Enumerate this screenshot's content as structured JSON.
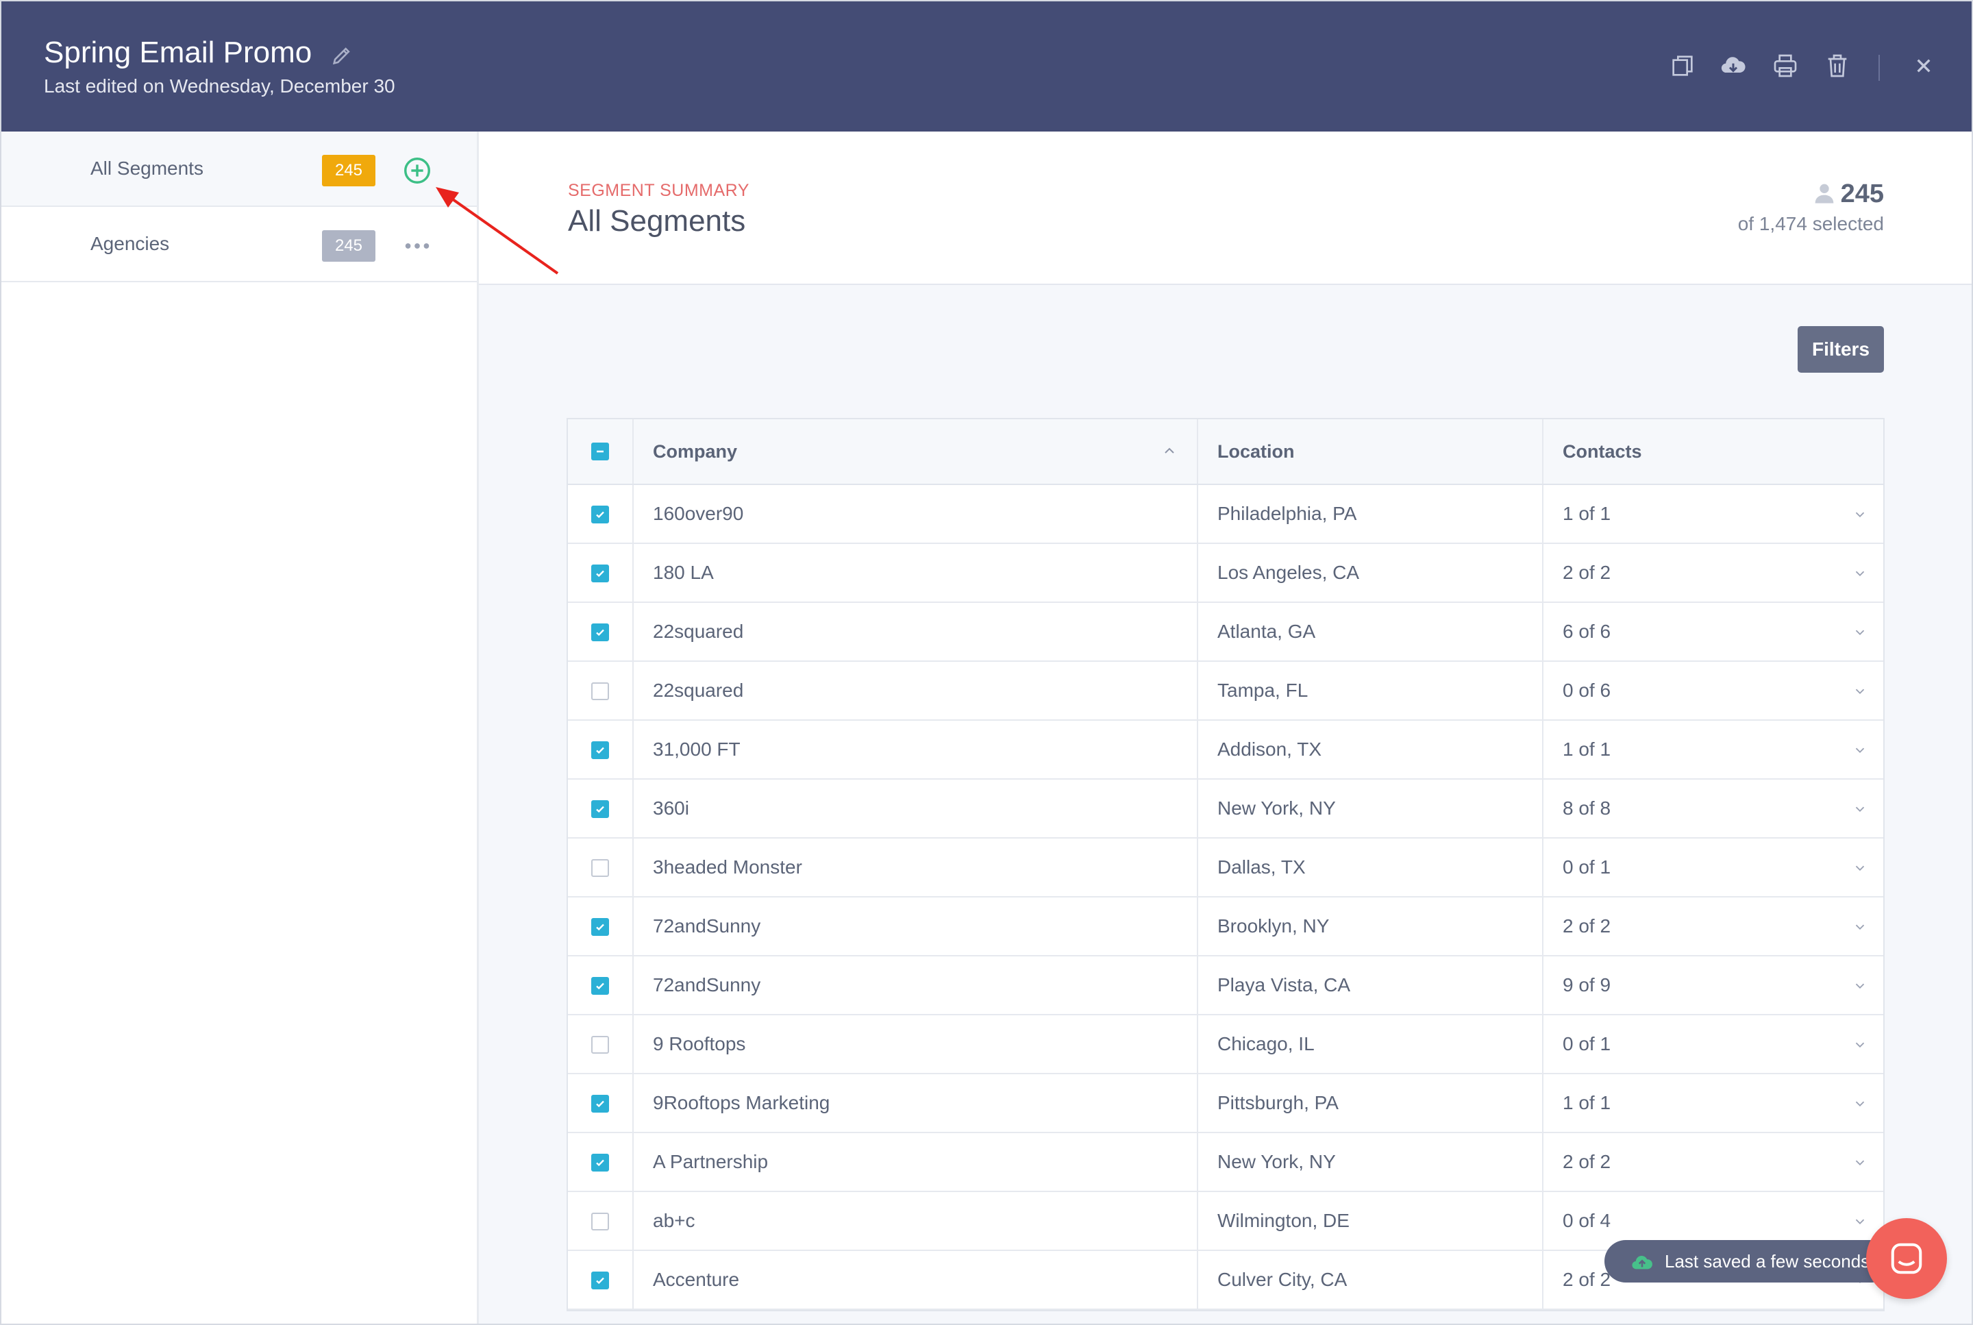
{
  "header": {
    "title": "Spring Email Promo",
    "subtitle": "Last edited on Wednesday, December 30"
  },
  "sidebar": {
    "segments": [
      {
        "label": "All Segments",
        "count": "245",
        "badge_color": "#f0a90c",
        "action_icon": "plus-circle-icon"
      },
      {
        "label": "Agencies",
        "count": "245",
        "badge_color": "#aeb4c4",
        "action_icon": "more-horizontal-icon"
      }
    ]
  },
  "summary": {
    "kicker": "SEGMENT SUMMARY",
    "title": "All Segments",
    "count": "245",
    "selected_text": "of 1,474 selected"
  },
  "filters_label": "Filters",
  "table": {
    "columns": [
      "Company",
      "Location",
      "Contacts"
    ],
    "rows": [
      {
        "company": "160over90",
        "location": "Philadelphia, PA",
        "contacts": "1 of 1",
        "checked": true
      },
      {
        "company": "180 LA",
        "location": "Los Angeles, CA",
        "contacts": "2 of 2",
        "checked": true
      },
      {
        "company": "22squared",
        "location": "Atlanta, GA",
        "contacts": "6 of 6",
        "checked": true
      },
      {
        "company": "22squared",
        "location": "Tampa, FL",
        "contacts": "0 of 6",
        "checked": false
      },
      {
        "company": "31,000 FT",
        "location": "Addison, TX",
        "contacts": "1 of 1",
        "checked": true
      },
      {
        "company": "360i",
        "location": "New York, NY",
        "contacts": "8 of 8",
        "checked": true
      },
      {
        "company": "3headed Monster",
        "location": "Dallas, TX",
        "contacts": "0 of 1",
        "checked": false
      },
      {
        "company": "72andSunny",
        "location": "Brooklyn, NY",
        "contacts": "2 of 2",
        "checked": true
      },
      {
        "company": "72andSunny",
        "location": "Playa Vista, CA",
        "contacts": "9 of 9",
        "checked": true
      },
      {
        "company": "9 Rooftops",
        "location": "Chicago, IL",
        "contacts": "0 of 1",
        "checked": false
      },
      {
        "company": "9Rooftops Marketing",
        "location": "Pittsburgh, PA",
        "contacts": "1 of 1",
        "checked": true
      },
      {
        "company": "A Partnership",
        "location": "New York, NY",
        "contacts": "2 of 2",
        "checked": true
      },
      {
        "company": "ab+c",
        "location": "Wilmington, DE",
        "contacts": "0 of 4",
        "checked": false
      },
      {
        "company": "Accenture",
        "location": "Culver City, CA",
        "contacts": "2 of 2",
        "checked": true
      }
    ]
  },
  "toast": {
    "text": "Last saved a few seconds ago"
  },
  "colors": {
    "header_bg": "#444c75",
    "accent_check": "#2bb0d6",
    "kicker": "#e56b6b",
    "chat": "#f2625b",
    "add_icon": "#3cbf86"
  }
}
